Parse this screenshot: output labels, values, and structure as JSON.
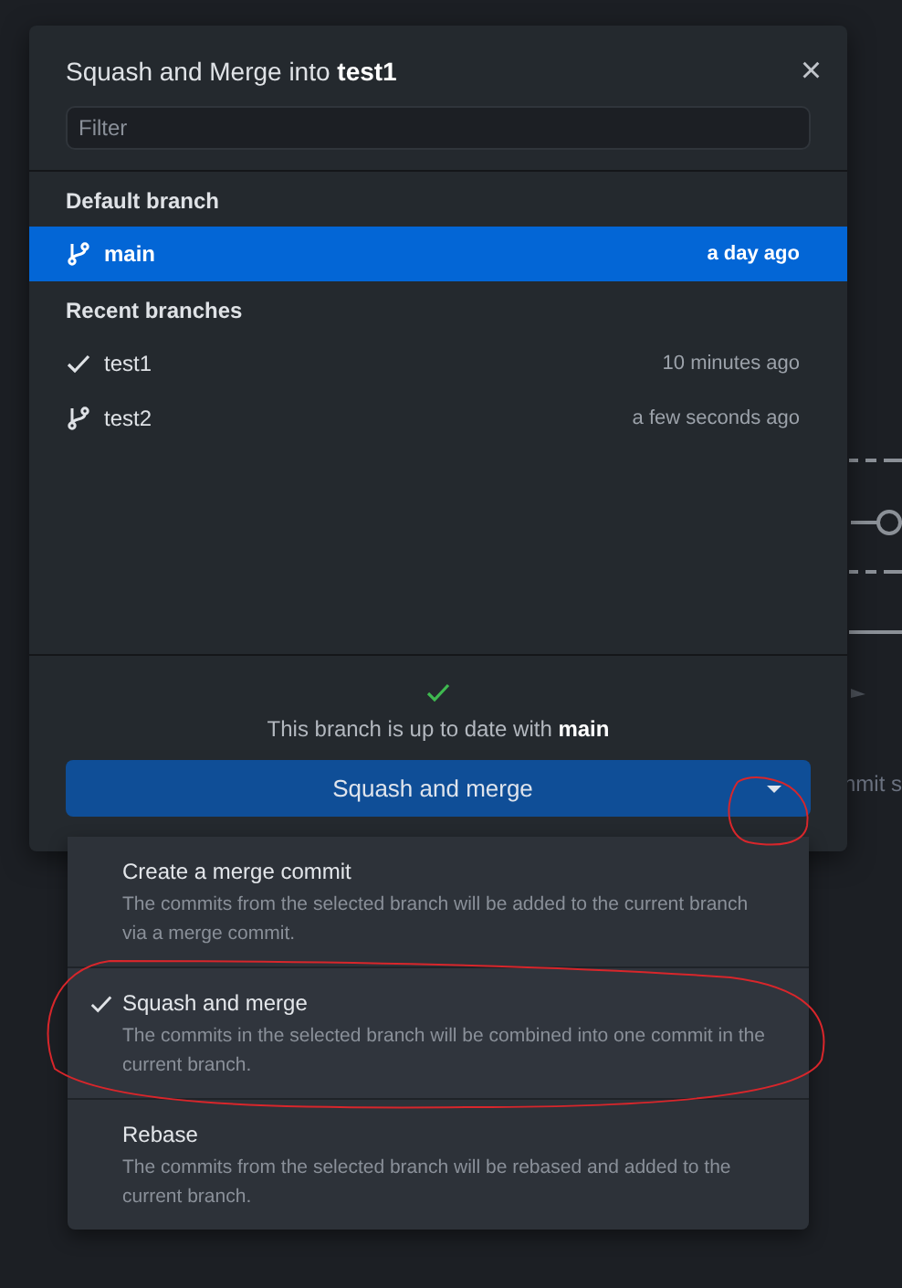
{
  "dialog": {
    "title": "Squash and Merge into **test1**",
    "close": "×",
    "filter": {
      "placeholder": "Filter"
    },
    "sections": [
      {
        "heading": "Default branch",
        "branches": [
          {
            "name": "main",
            "time": "a day ago",
            "selected": true,
            "current": false
          }
        ]
      },
      {
        "heading": "Recent branches",
        "branches": [
          {
            "name": "test1",
            "time": "10 minutes ago",
            "selected": false,
            "current": true
          },
          {
            "name": "test2",
            "time": "a few seconds ago",
            "selected": false,
            "current": false
          }
        ]
      }
    ],
    "status": "This branch is up to date with **main**",
    "merge_button": {
      "label": "Squash and merge"
    }
  },
  "merge_menu": {
    "options": [
      {
        "title": "Create a merge commit",
        "description": "The commits from the selected branch will be added to the current branch via a merge commit.",
        "selected": false
      },
      {
        "title": "Squash and merge",
        "description": "The commits in the selected branch will be combined into one commit in the current branch.",
        "selected": true
      },
      {
        "title": "Rebase",
        "description": "The commits from the selected branch will be rebased and added to the current branch.",
        "selected": false
      }
    ]
  },
  "background_text": "nmit s"
}
